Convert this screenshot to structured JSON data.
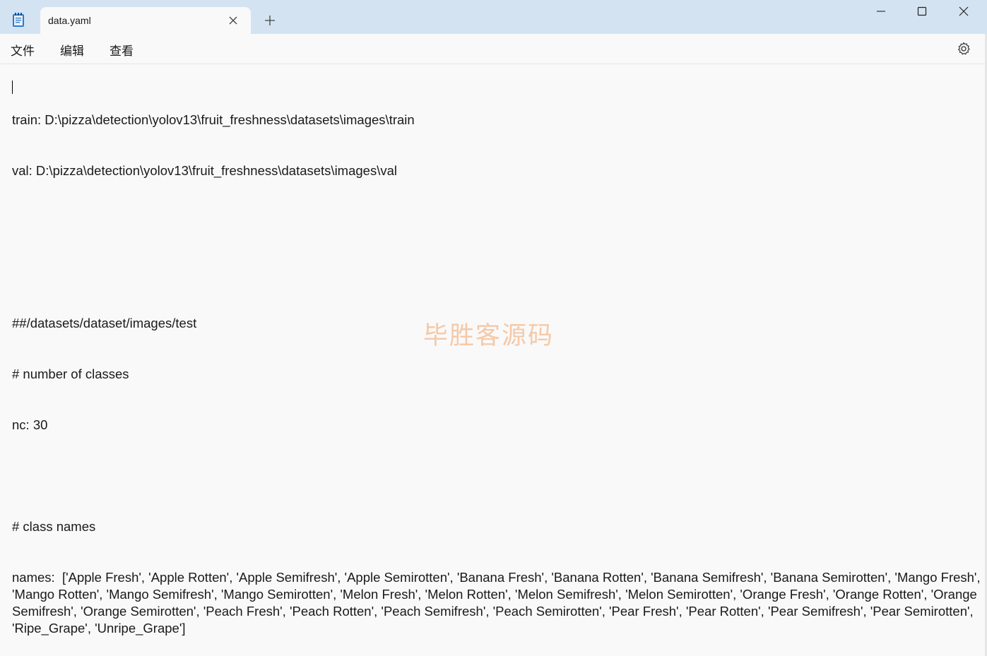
{
  "tab": {
    "title": "data.yaml"
  },
  "menu": {
    "file": "文件",
    "edit": "编辑",
    "view": "查看"
  },
  "editor": {
    "lines": [
      "train: D:\\pizza\\detection\\yolov13\\fruit_freshness\\datasets\\images\\train",
      "val: D:\\pizza\\detection\\yolov13\\fruit_freshness\\datasets\\images\\val",
      "",
      "",
      "##/datasets/dataset/images/test",
      "# number of classes",
      "nc: 30",
      "",
      "# class names",
      "names:  ['Apple Fresh', 'Apple Rotten', 'Apple Semifresh', 'Apple Semirotten', 'Banana Fresh', 'Banana Rotten', 'Banana Semifresh', 'Banana Semirotten', 'Mango Fresh', 'Mango Rotten', 'Mango Semifresh', 'Mango Semirotten', 'Melon Fresh', 'Melon Rotten', 'Melon Semifresh', 'Melon Semirotten', 'Orange Fresh', 'Orange Rotten', 'Orange Semifresh', 'Orange Semirotten', 'Peach Fresh', 'Peach Rotten', 'Peach Semifresh', 'Peach Semirotten', 'Pear Fresh', 'Pear Rotten', 'Pear Semifresh', 'Pear Semirotten', 'Ripe_Grape', 'Unripe_Grape']"
    ]
  },
  "watermark": "毕胜客源码",
  "icons": {
    "app": "notepad-icon",
    "close_tab": "close-icon",
    "new_tab": "plus-icon",
    "minimize": "minimize-icon",
    "maximize": "maximize-icon",
    "close_window": "close-icon",
    "settings": "gear-icon"
  },
  "colors": {
    "titlebar": "#d3e3f1",
    "editor_bg": "#f9f9f9",
    "watermark": "#f5c9a8"
  }
}
